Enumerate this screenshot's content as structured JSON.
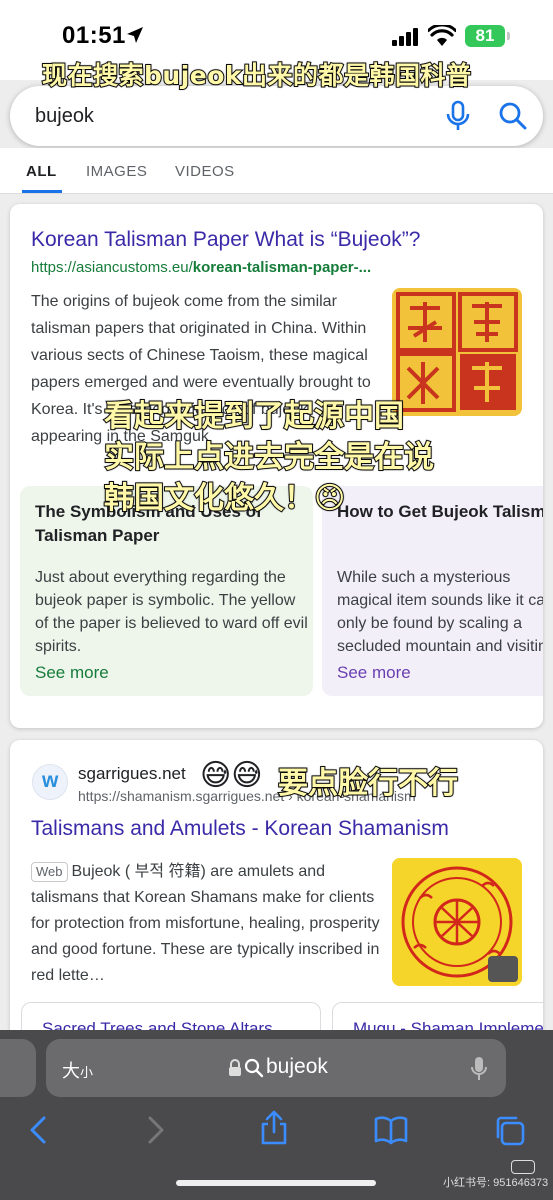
{
  "status": {
    "time": "01:51",
    "battery": "81"
  },
  "captions": {
    "top": "现在搜索bujeok出来的都是韩国科普",
    "mid_line1": "看起来提到了起源中国",
    "mid_line2": "实际上点进去完全是在说",
    "mid_line3": "韩国文化悠久！😠",
    "lower_emoji": "😅😅",
    "lower_text": "要点脸行不行"
  },
  "search": {
    "query": "bujeok"
  },
  "tabs": [
    {
      "label": "ALL",
      "active": true
    },
    {
      "label": "IMAGES",
      "active": false
    },
    {
      "label": "VIDEOS",
      "active": false
    }
  ],
  "result1": {
    "title": "Korean Talisman Paper What is “Bujeok”?",
    "url_base": "https://asiancustoms.eu/",
    "url_path": "korean-talisman-paper-...",
    "snippet": "The origins of bujeok come from the similar talisman papers that originated in China. Within various sects of Chinese Taoism, these magical papers emerged and were eventually brought to Korea. It's recorded evidence of bujeok appearing in the Samguk",
    "sub1": {
      "title": "The Symbolism and Uses of Talisman Paper",
      "body": "Just about everything regarding the bujeok paper is symbolic. The yellow of the paper is believed to ward off evil spirits.",
      "see_more": "See more"
    },
    "sub2": {
      "title": "How to Get Bujeok Talisman",
      "body": "While such a mysterious magical item sounds like it can only be found by scaling a secluded mountain and visiting the hidden abode of an immortal",
      "see_more": "See more"
    }
  },
  "result2": {
    "site": "sgarrigues.net",
    "url": "https://shamanism.sgarrigues.net › korean-shamanism",
    "title": "Talismans and Amulets - Korean Shamanism",
    "badge": "Web",
    "snippet": "Bujeok ( 부적 符籍) are amulets and talismans that Korean Shamans make for clients for protection from misfortune, healing, prosperity and good fortune. These are typically inscribed in red lette…",
    "chip1": "Sacred Trees and Stone Altars",
    "chip2": "Mugu - Shaman Implements"
  },
  "safari": {
    "text_size": "大",
    "text_size_small": "小",
    "url": "bujeok"
  },
  "watermark": "小红书号: 951646373",
  "colors": {
    "link": "#3a2aa8",
    "url_green": "#167c3a",
    "accent": "#1a73e8",
    "caption": "#fff8a8"
  }
}
